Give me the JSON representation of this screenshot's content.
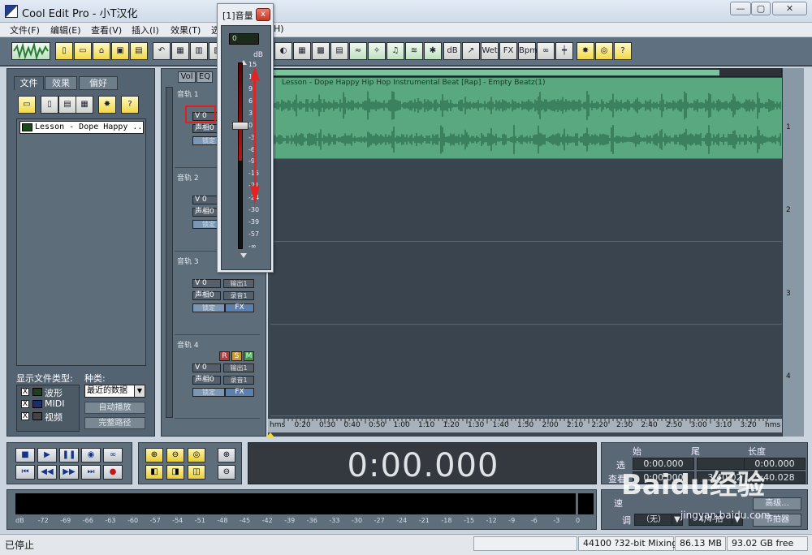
{
  "window": {
    "title": "Cool Edit Pro  - 小T汉化",
    "minimize": "—",
    "restore": "▢",
    "close": "✕"
  },
  "menu": [
    "文件(F)",
    "编辑(E)",
    "查看(V)",
    "插入(I)",
    "效果(T)",
    "选",
    "H)"
  ],
  "toolbar_icons": [
    "waveform-mode-icon",
    "new-icon",
    "open-icon",
    "close-file-icon",
    "save-icon",
    "save-all-icon",
    "undo-icon",
    "copy-icon",
    "paste-icon",
    "settings-icon"
  ],
  "toolbar_right": {
    "db": "dB",
    "wet": "Wet",
    "fx": "FX",
    "bpm": "Bpm",
    "help": "?"
  },
  "left_panel": {
    "tabs": [
      "文件",
      "效果",
      "偏好"
    ],
    "file_item": "Lesson - Dope Happy ...",
    "show_types_label": "显示文件类型:",
    "kind_label": "种类:",
    "types": [
      {
        "label": "波形",
        "checked": "X"
      },
      {
        "label": "MIDI",
        "checked": "X"
      },
      {
        "label": "视频",
        "checked": "X"
      }
    ],
    "kind_select": "最近的数据",
    "autoplay": "自动播放",
    "fullpath": "完整路径",
    "help": "?"
  },
  "track_panel": {
    "tabs": [
      "Vol",
      "EQ"
    ],
    "tracks": [
      {
        "name": "音轨 1",
        "volume": "V 0",
        "pan": "声相0",
        "out": "输出1",
        "rec": "录音1",
        "lock": "锁定",
        "fx": "FX"
      },
      {
        "name": "音轨 2",
        "volume": "V 0",
        "pan": "声相0",
        "out": "输出1",
        "rec": "录音1",
        "lock": "锁定",
        "fx": "FX"
      },
      {
        "name": "音轨 3",
        "volume": "V 0",
        "pan": "声相0",
        "out": "输出1",
        "rec": "录音1",
        "lock": "锁定",
        "fx": "FX"
      },
      {
        "name": "音轨 4",
        "volume": "V 0",
        "pan": "声相0",
        "out": "输出1",
        "rec": "录音1",
        "lock": "锁定",
        "fx": "FX"
      }
    ],
    "rsm": [
      "R",
      "S",
      "M"
    ]
  },
  "clip": {
    "title": "Lesson - Dope Happy Hip Hop Instrumental Beat [Rap] - Empty Beatz(1)"
  },
  "track_numbers": [
    "1",
    "2",
    "3",
    "4"
  ],
  "timeline": [
    "hms",
    "0:20",
    "0:30",
    "0:40",
    "0:50",
    "1:00",
    "1:10",
    "1:20",
    "1:30",
    "1:40",
    "1:50",
    "2:00",
    "2:10",
    "2:20",
    "2:30",
    "2:40",
    "2:50",
    "3:00",
    "3:10",
    "3:20",
    "hms"
  ],
  "time_display": "0:00.000",
  "selection": {
    "headers": [
      "始",
      "尾",
      "长度"
    ],
    "rows": [
      {
        "label": "选",
        "begin": "0:00.000",
        "end": "",
        "length": "0:00.000"
      },
      {
        "label": "查看",
        "begin": "0:00.000",
        "end": "3:40.027",
        "length": "3:40.028"
      }
    ]
  },
  "meter_db": [
    "dB",
    "-72",
    "-69",
    "-66",
    "-63",
    "-60",
    "-57",
    "-54",
    "-51",
    "-48",
    "-45",
    "-42",
    "-39",
    "-36",
    "-33",
    "-30",
    "-27",
    "-24",
    "-21",
    "-18",
    "-15",
    "-12",
    "-9",
    "-6",
    "-3",
    "0"
  ],
  "speed": {
    "speed_label": "速",
    "beat_label": "调",
    "key_value": "（无）",
    "meter_value": "4/4-拍",
    "advanced": "高级...",
    "extract": "节拍器"
  },
  "status": {
    "text": "已停止",
    "rate": "44100 ?32-bit Mixing",
    "mem": "86.13 MB",
    "disk": "93.02 GB free"
  },
  "volume_popup": {
    "title": "[1]音量",
    "close": "x",
    "value": "0",
    "unit": "dB",
    "ticks": [
      "15",
      "12",
      "9",
      "6",
      "3",
      "0",
      "-3",
      "-6",
      "-9",
      "-15",
      "-21",
      "-24",
      "-30",
      "-39",
      "-57",
      "-∞"
    ],
    "level": 0
  },
  "watermark": {
    "text": "Baidu经验",
    "url": "jingyan.baidu.com"
  }
}
